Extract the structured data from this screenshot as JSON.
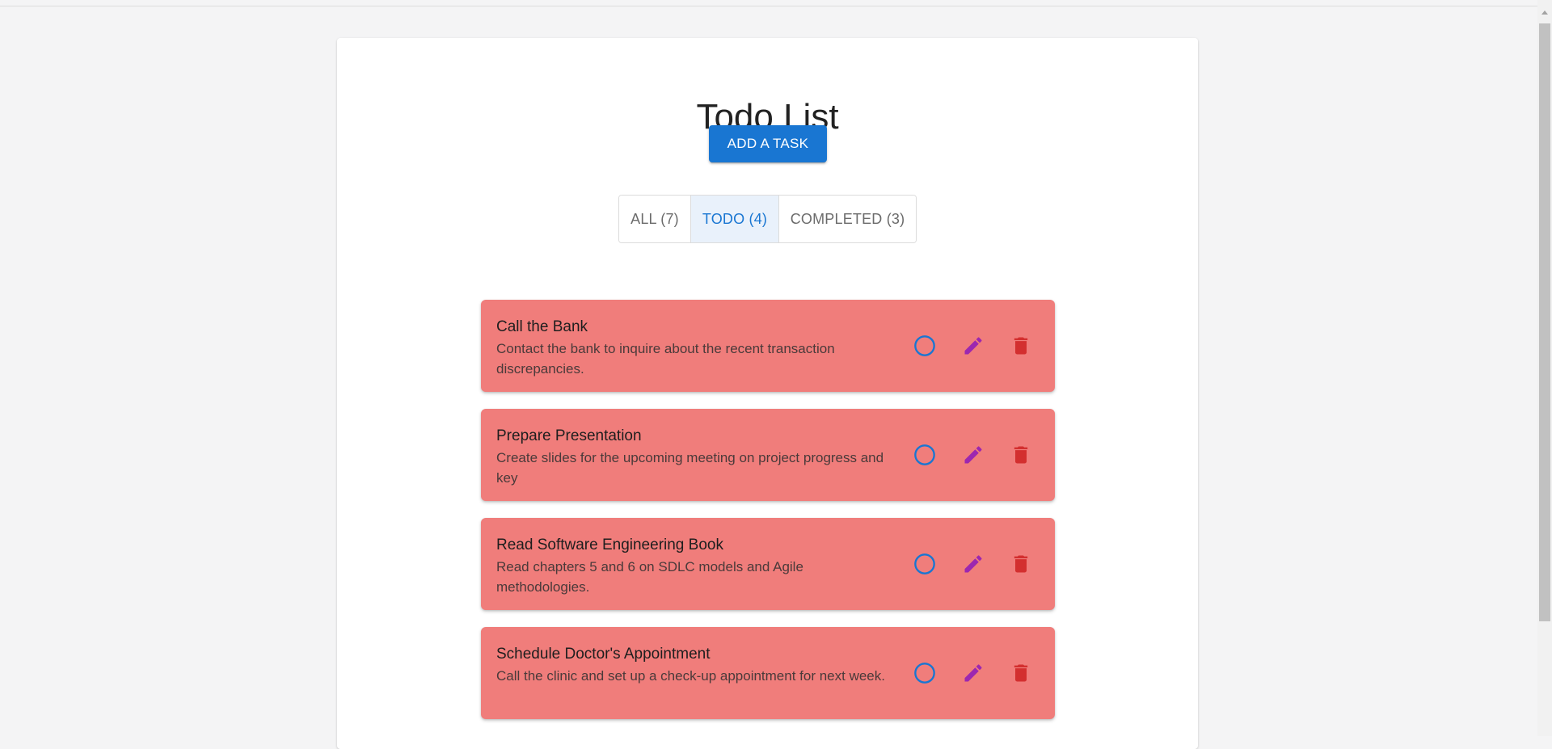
{
  "header": {
    "title": "Todo List",
    "add_label": "ADD A TASK"
  },
  "filters": [
    {
      "label": "ALL (7)",
      "active": false
    },
    {
      "label": "TODO (4)",
      "active": true
    },
    {
      "label": "COMPLETED (3)",
      "active": false
    }
  ],
  "tasks": [
    {
      "title": "Call the Bank",
      "description": "Contact the bank to inquire about the recent transaction discrepancies."
    },
    {
      "title": "Prepare Presentation",
      "description": "Create slides for the upcoming meeting on project progress and key"
    },
    {
      "title": "Read Software Engineering Book",
      "description": "Read chapters 5 and 6 on SDLC models and Agile methodologies."
    },
    {
      "title": "Schedule Doctor's Appointment",
      "description": "Call the clinic and set up a check-up appointment for next week."
    }
  ],
  "icons": {
    "complete": "circle-outline-icon",
    "edit": "pencil-icon",
    "delete": "trash-icon"
  },
  "colors": {
    "primary": "#1976d2",
    "task_background": "#f07d7b",
    "complete_icon": "#1976d2",
    "edit_icon": "#9c27b0",
    "delete_icon": "#d32f2f"
  }
}
